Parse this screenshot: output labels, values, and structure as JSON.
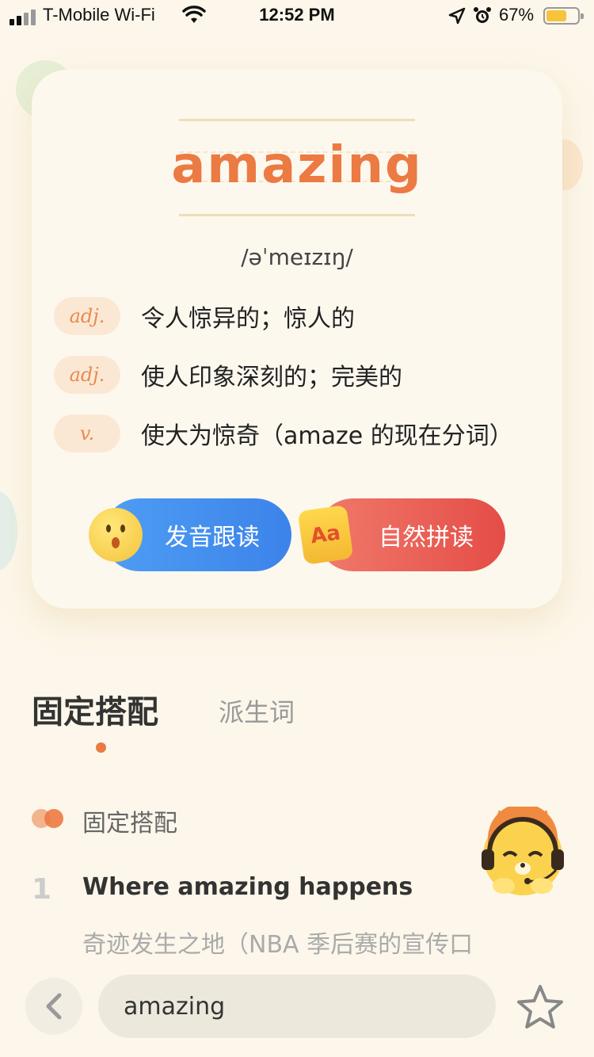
{
  "status_bar": {
    "carrier": "T-Mobile Wi-Fi",
    "time": "12:52 PM",
    "battery_percent": "67%",
    "battery_level": 0.67,
    "icons": [
      "signal-icon",
      "wifi-icon",
      "location-icon",
      "alarm-icon",
      "battery-icon"
    ]
  },
  "word_card": {
    "word": "amazing",
    "phonetic": "/əˈmeɪzɪŋ/",
    "definitions": [
      {
        "pos": "adj.",
        "text": "令人惊异的；惊人的"
      },
      {
        "pos": "adj.",
        "text": "使人印象深刻的；完美的"
      },
      {
        "pos": "v.",
        "text": "使大为惊奇（amaze 的现在分词）"
      }
    ],
    "follow_read_label": "发音跟读",
    "phonics_label": "自然拼读",
    "phonics_icon_text": "Aa"
  },
  "tabs": {
    "items": [
      "固定搭配",
      "派生词"
    ],
    "active": "固定搭配"
  },
  "collocations": {
    "section_title": "固定搭配",
    "items": [
      {
        "number": "1",
        "en": "Where amazing happens",
        "cn": "奇迹发生之地（NBA 季后赛的宣传口"
      }
    ]
  },
  "bottom_bar": {
    "search_value": "amazing",
    "icons": [
      "back-chevron-icon",
      "star-icon"
    ]
  },
  "colors": {
    "accent_orange": "#ec7a43",
    "pos_badge_bg": "#fbe8d4",
    "follow_read_blue": "#3c83ea",
    "phonics_red": "#e54d47",
    "background": "#fcf7ea"
  }
}
